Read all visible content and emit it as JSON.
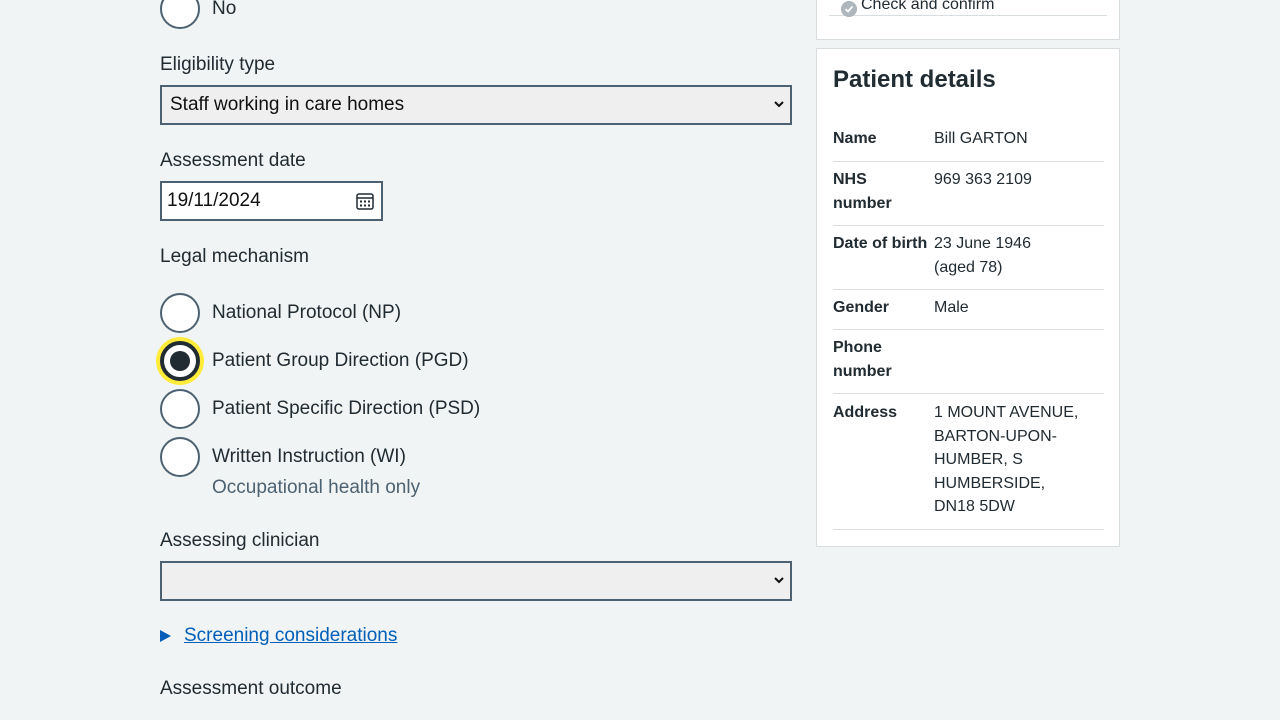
{
  "form": {
    "previous_radio_no_label": "No",
    "eligibility": {
      "label": "Eligibility type",
      "selected": "Staff working in care homes"
    },
    "assessment_date": {
      "label": "Assessment date",
      "value": "19/11/2024"
    },
    "legal_mechanism": {
      "label": "Legal mechanism",
      "options": [
        {
          "label": "National Protocol (NP)",
          "checked": false
        },
        {
          "label": "Patient Group Direction (PGD)",
          "checked": true
        },
        {
          "label": "Patient Specific Direction (PSD)",
          "checked": false
        },
        {
          "label": "Written Instruction (WI)",
          "checked": false,
          "hint": "Occupational health only"
        }
      ]
    },
    "assessing_clinician": {
      "label": "Assessing clinician",
      "selected": ""
    },
    "screening_link": "Screening considerations",
    "assessment_outcome_label": "Assessment outcome"
  },
  "sidebar": {
    "progress_item": "Check and confirm",
    "patient_details": {
      "title": "Patient details",
      "rows": [
        {
          "key": "Name",
          "value": "Bill GARTON"
        },
        {
          "key": "NHS number",
          "value": "969 363 2109"
        },
        {
          "key": "Date of birth",
          "value": "23 June 1946 (aged 78)"
        },
        {
          "key": "Gender",
          "value": "Male"
        },
        {
          "key": "Phone number",
          "value": ""
        },
        {
          "key": "Address",
          "value": "1 MOUNT AVENUE, BARTON-UPON-HUMBER, S HUMBERSIDE, DN18 5DW"
        }
      ]
    }
  },
  "colors": {
    "background": "#f0f4f5",
    "link": "#005eb8",
    "focus": "#ffeb3b",
    "text": "#212b32",
    "border": "#4c6272"
  }
}
